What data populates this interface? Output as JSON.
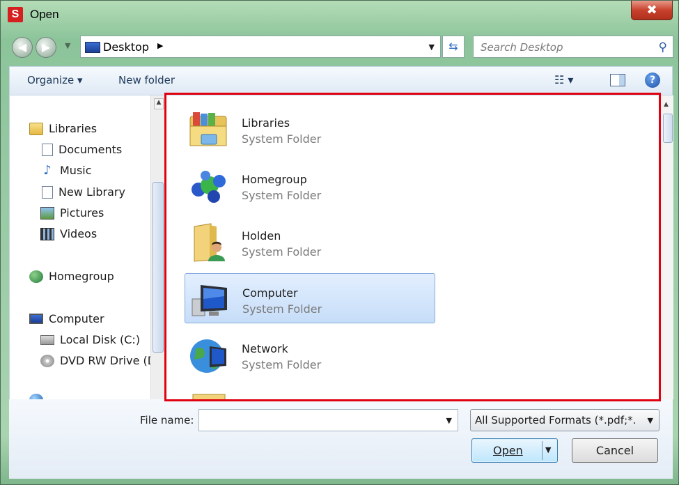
{
  "window": {
    "app_icon": "S",
    "title": "Open",
    "close_glyph": "✖"
  },
  "addressbar": {
    "location": "Desktop",
    "search_placeholder": "Search Desktop"
  },
  "toolbar": {
    "organize": "Organize ▾",
    "new_folder": "New folder",
    "help": "?"
  },
  "sidebar": {
    "libraries": "Libraries",
    "documents": "Documents",
    "music": "Music",
    "new_library": "New Library",
    "pictures": "Pictures",
    "videos": "Videos",
    "homegroup": "Homegroup",
    "computer": "Computer",
    "local_disk": "Local Disk (C:)",
    "dvd_drive": "DVD RW Drive (D"
  },
  "files": [
    {
      "name": "Libraries",
      "type": "System Folder"
    },
    {
      "name": "Homegroup",
      "type": "System Folder"
    },
    {
      "name": "Holden",
      "type": "System Folder"
    },
    {
      "name": "Computer",
      "type": "System Folder",
      "selected": true
    },
    {
      "name": "Network",
      "type": "System Folder"
    }
  ],
  "bottom": {
    "file_name_label": "File name:",
    "file_name_value": "",
    "format": "All Supported Formats (*.pdf;*.",
    "open_label": "Open",
    "cancel_label": "Cancel"
  },
  "colors": {
    "highlight_box": "#e00010",
    "selection": "#c6ddf8",
    "frame": "#8cc49a"
  }
}
